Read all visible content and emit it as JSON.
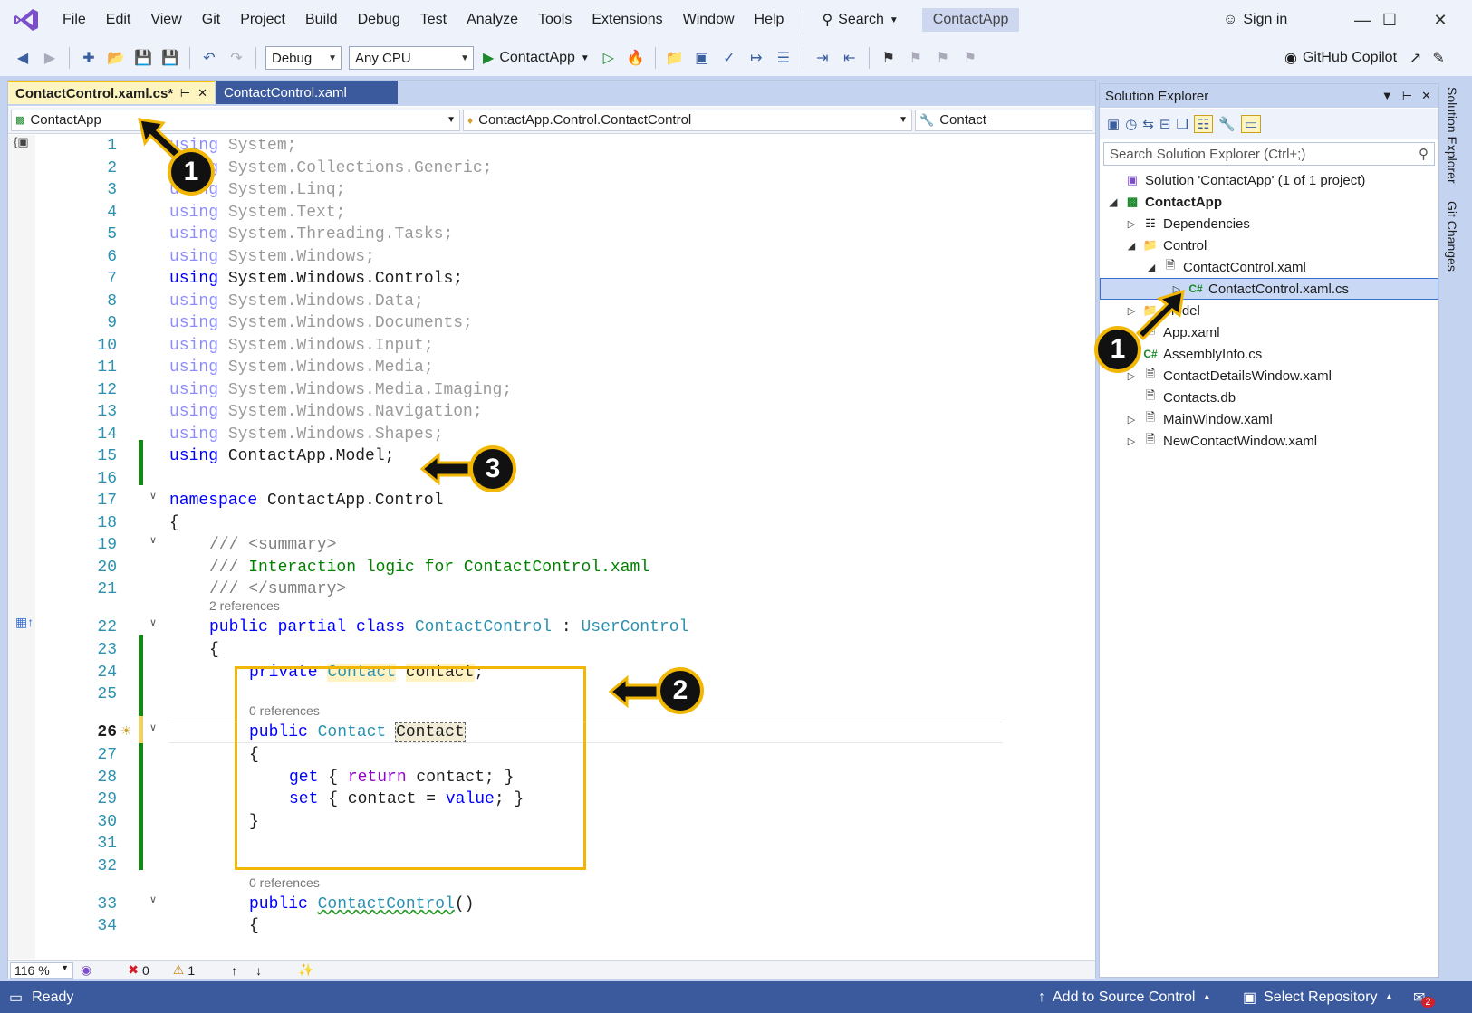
{
  "menu": {
    "items": [
      "File",
      "Edit",
      "View",
      "Git",
      "Project",
      "Build",
      "Debug",
      "Test",
      "Analyze",
      "Tools",
      "Extensions",
      "Window",
      "Help"
    ],
    "search_label": "Search",
    "solution_name": "ContactApp",
    "sign_in": "Sign in"
  },
  "toolbar": {
    "config": "Debug",
    "platform": "Any CPU",
    "run_target": "ContactApp",
    "copilot": "GitHub Copilot"
  },
  "editor": {
    "tabs": [
      {
        "label": "ContactControl.xaml.cs*",
        "active": true
      },
      {
        "label": "ContactControl.xaml",
        "active": false
      }
    ],
    "nav": {
      "project": "ContactApp",
      "type": "ContactApp.Control.ContactControl",
      "member": "Contact"
    },
    "zoom": "116 %",
    "errors": "0",
    "warnings": "1",
    "references": {
      "class_refs": "2 references",
      "prop_refs": "0 references",
      "ctor_refs": "0 references"
    },
    "lines": {
      "l1": [
        "using",
        " System;"
      ],
      "l2": [
        "using",
        " System.Collections.Generic;"
      ],
      "l3": [
        "using",
        " System.Linq;"
      ],
      "l4": [
        "using",
        " System.Text;"
      ],
      "l5": [
        "using",
        " System.Threading.Tasks;"
      ],
      "l6": [
        "using",
        " System.Windows;"
      ],
      "l7": [
        "using",
        " System.Windows.Controls;"
      ],
      "l8": [
        "using",
        " System.Windows.Data;"
      ],
      "l9": [
        "using",
        " System.Windows.Documents;"
      ],
      "l10": [
        "using",
        " System.Windows.Input;"
      ],
      "l11": [
        "using",
        " System.Windows.Media;"
      ],
      "l12": [
        "using",
        " System.Windows.Media.Imaging;"
      ],
      "l13": [
        "using",
        " System.Windows.Navigation;"
      ],
      "l14": [
        "using",
        " System.Windows.Shapes;"
      ],
      "l15": [
        "using",
        " ContactApp.Model;"
      ],
      "l17": [
        "namespace",
        " ContactApp.Control"
      ],
      "l18": "{",
      "l19": [
        "///",
        " <summary>"
      ],
      "l20": [
        "///",
        " Interaction logic for ContactControl.xaml"
      ],
      "l21": [
        "///",
        " </summary>"
      ],
      "l22": [
        "public partial class",
        " ",
        "ContactControl",
        " : ",
        "UserControl"
      ],
      "l23": "{",
      "l24": [
        "private",
        " ",
        "Contact",
        " ",
        "contact",
        ";"
      ],
      "l26": [
        "public",
        " ",
        "Contact",
        " ",
        "Contact"
      ],
      "l27": "{",
      "l28": [
        "get",
        " { ",
        "return",
        " contact; }"
      ],
      "l29": [
        "set",
        " { contact = ",
        "value",
        "; }"
      ],
      "l30": "}",
      "l33": [
        "public",
        " ",
        "ContactControl",
        "()"
      ],
      "l34": "{"
    },
    "line_numbers": [
      "1",
      "2",
      "3",
      "4",
      "5",
      "6",
      "7",
      "8",
      "9",
      "10",
      "11",
      "12",
      "13",
      "14",
      "15",
      "16",
      "17",
      "18",
      "19",
      "20",
      "21",
      "22",
      "23",
      "24",
      "25",
      "26",
      "27",
      "28",
      "29",
      "30",
      "31",
      "32",
      "33",
      "34"
    ]
  },
  "solution_explorer": {
    "title": "Solution Explorer",
    "search_placeholder": "Search Solution Explorer (Ctrl+;)",
    "tree": {
      "solution": "Solution 'ContactApp' (1 of 1 project)",
      "project": "ContactApp",
      "dependencies": "Dependencies",
      "control": "Control",
      "contactcontrol_xaml": "ContactControl.xaml",
      "contactcontrol_cs": "ContactControl.xaml.cs",
      "model": "Model",
      "app_xaml": "App.xaml",
      "assemblyinfo": "AssemblyInfo.cs",
      "details_window": "ContactDetailsWindow.xaml",
      "contacts_db": "Contacts.db",
      "main_window": "MainWindow.xaml",
      "new_contact_window": "NewContactWindow.xaml"
    },
    "cs_badge": "C#"
  },
  "side_rail": {
    "solution_explorer": "Solution Explorer",
    "git_changes": "Git Changes"
  },
  "statusbar": {
    "ready": "Ready",
    "add_source": "Add to Source Control",
    "select_repo": "Select Repository",
    "notif_count": "2"
  },
  "callouts": {
    "c1a": "1",
    "c1b": "1",
    "c2": "2",
    "c3": "3"
  },
  "colors": {
    "accent": "#f2b705",
    "statusbar": "#3b5a9e",
    "keyword": "#0000ff",
    "type": "#2b91af",
    "comment": "#008000"
  }
}
